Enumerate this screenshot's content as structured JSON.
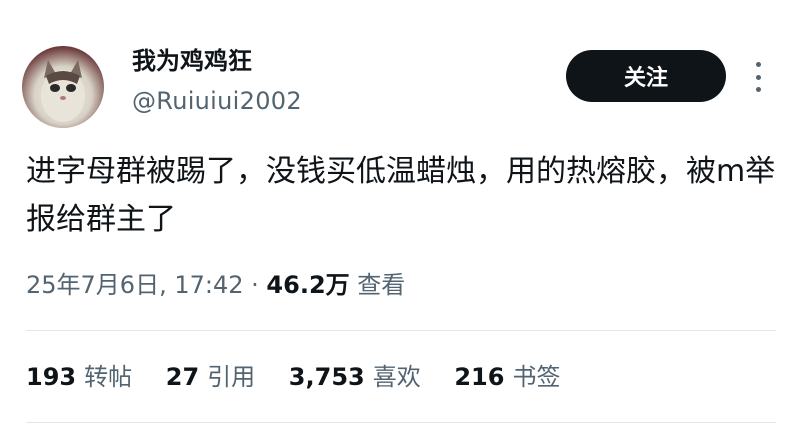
{
  "user": {
    "display_name": "我为鸡鸡狂",
    "handle": "@Ruiuiui2002",
    "follow_label": "关注"
  },
  "tweet": {
    "text": "进字母群被踢了，没钱买低温蜡烛，用的热熔胶，被m举报给群主了",
    "date": "25年7月6日, 17:42",
    "separator": "·",
    "views": "46.2万",
    "views_label": "查看"
  },
  "stats": {
    "retweets": {
      "count": "193",
      "label": "转帖"
    },
    "quotes": {
      "count": "27",
      "label": "引用"
    },
    "likes": {
      "count": "3,753",
      "label": "喜欢"
    },
    "bookmarks": {
      "count": "216",
      "label": "书签"
    }
  },
  "colors": {
    "text": "#0f1419",
    "secondary": "#536471",
    "button_bg": "#0f1419",
    "divider": "#e1e6ea"
  }
}
